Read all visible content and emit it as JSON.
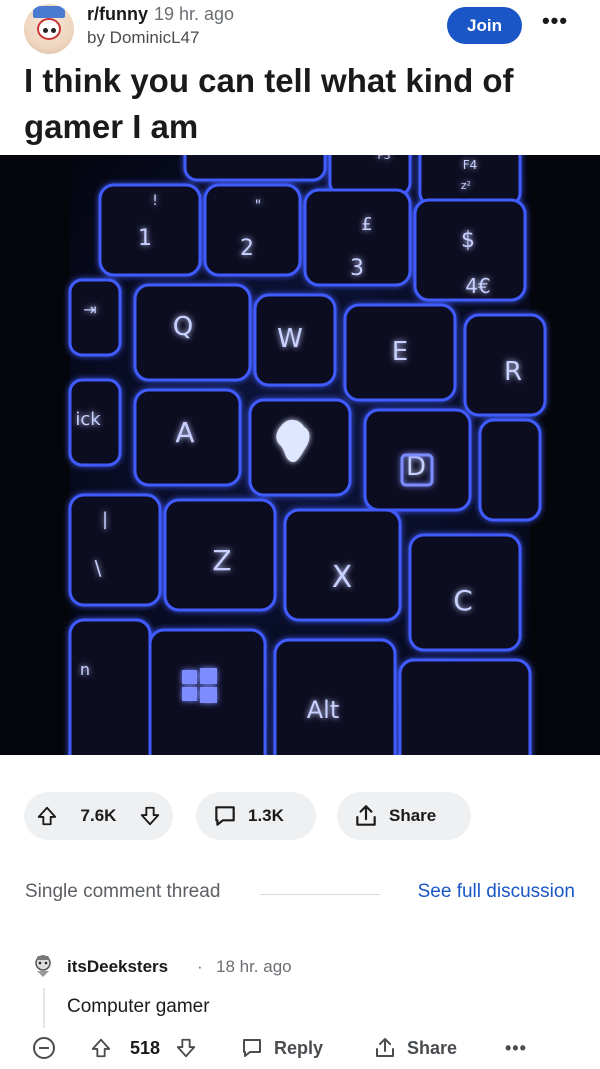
{
  "post": {
    "subreddit": "r/funny",
    "time": "19 hr. ago",
    "author": "by DominicL47",
    "join_label": "Join",
    "more_label": "•••",
    "title": "I think you can tell what kind of gamer I am"
  },
  "image": {
    "key_labels": {
      "f3": "F3",
      "f4": "F4",
      "f4_sub": "z²",
      "k1_top": "!",
      "k1": "1",
      "k2_top": "\"",
      "k2": "2",
      "k3_top": "£",
      "k3": "3",
      "k4_top": "$",
      "k4": "4€",
      "tab": "⇥",
      "q": "Q",
      "w": "W",
      "e": "E",
      "r": "R",
      "caps": "ick",
      "a": "A",
      "d": "D",
      "shift_top": "|",
      "shift": "\\",
      "z": "Z",
      "x": "X",
      "c": "C",
      "fn": "n",
      "alt": "Alt"
    }
  },
  "actions": {
    "score": "7.6K",
    "comments": "1.3K",
    "share_label": "Share"
  },
  "thread": {
    "label": "Single comment thread",
    "see_full": "See full discussion"
  },
  "comment": {
    "user": "itsDeeksters",
    "dot": "·",
    "time": "18 hr. ago",
    "body": "Computer gamer",
    "score": "518",
    "reply_label": "Reply",
    "share_label": "Share",
    "more_label": "•••"
  },
  "colors": {
    "join_bg": "#1a56c6",
    "link": "#1a56c6",
    "pill_bg": "#eef0f2",
    "key_glow": "#3b5bff"
  }
}
